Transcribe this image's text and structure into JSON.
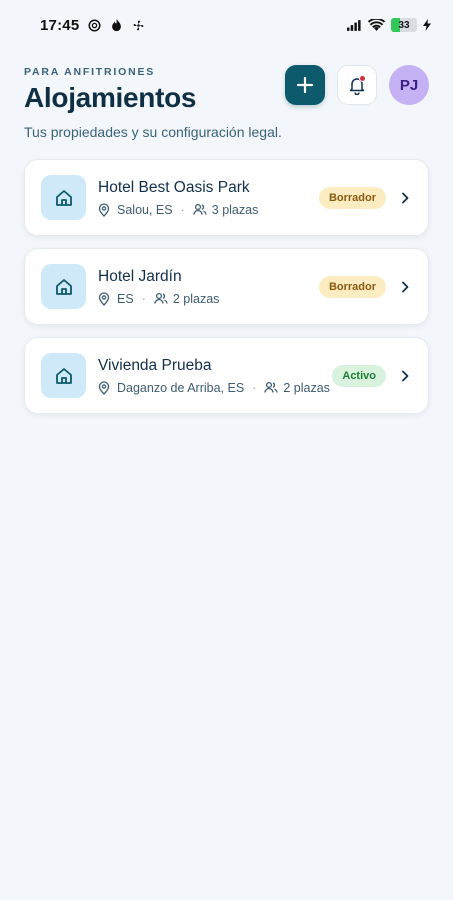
{
  "status_bar": {
    "time": "17:45",
    "battery": 33
  },
  "header": {
    "eyebrow": "PARA ANFITRIONES",
    "title": "Alojamientos",
    "subtitle": "Tus propiedades y su configuración legal.",
    "avatar_initials": "PJ"
  },
  "colors": {
    "primary": "#0c5a6b",
    "badge_draft_bg": "#fbecc2",
    "badge_draft_fg": "#8a5a0f",
    "badge_active_bg": "#d8f2dd",
    "badge_active_fg": "#1e7a35"
  },
  "properties": [
    {
      "name": "Hotel Best Oasis Park",
      "location": "Salou, ES",
      "capacity": "3 plazas",
      "status": "Borrador",
      "status_kind": "draft"
    },
    {
      "name": "Hotel Jardín",
      "location": "ES",
      "capacity": "2 plazas",
      "status": "Borrador",
      "status_kind": "draft"
    },
    {
      "name": "Vivienda Prueba",
      "location": "Daganzo de Arriba, ES",
      "capacity": "2 plazas",
      "status": "Activo",
      "status_kind": "active"
    }
  ]
}
